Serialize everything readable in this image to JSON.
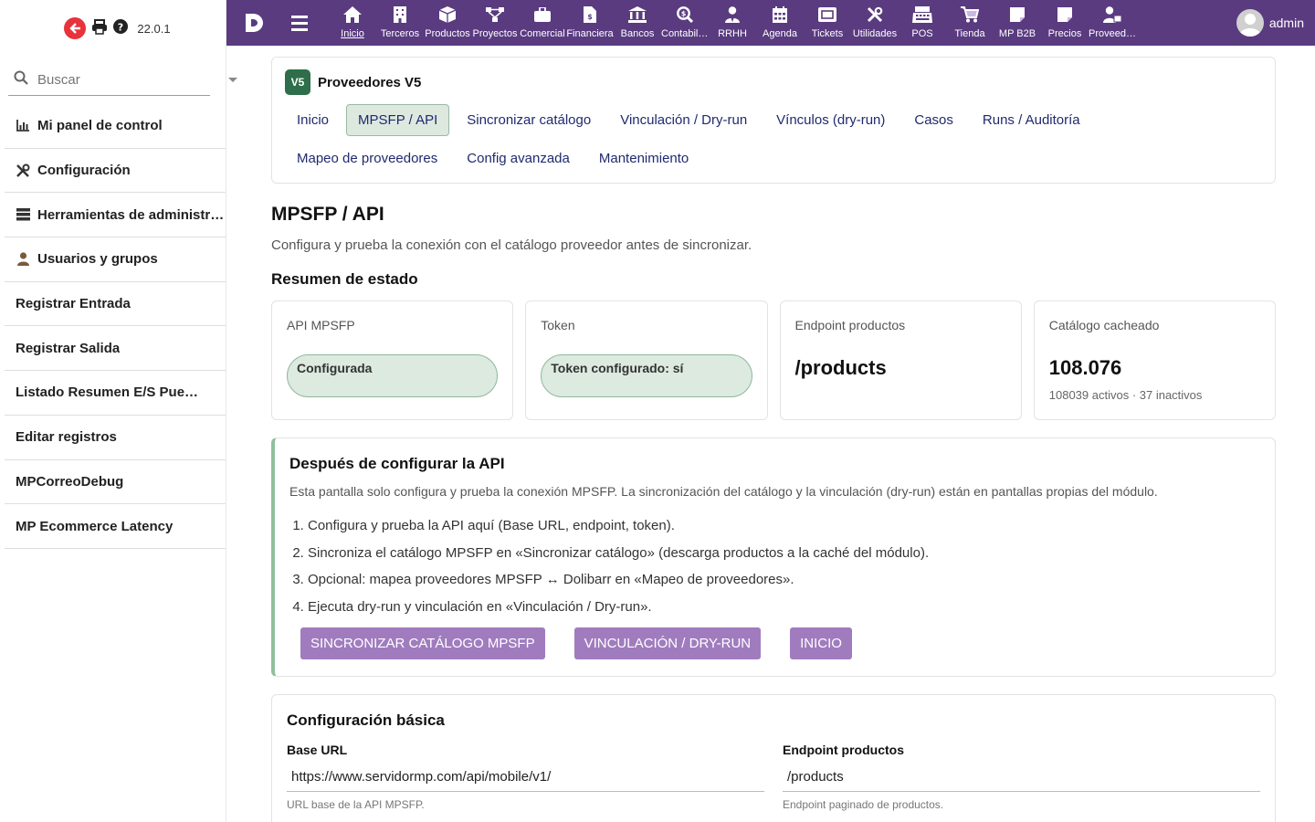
{
  "app": {
    "version": "22.0.1"
  },
  "sidebar": {
    "search_placeholder": "Buscar",
    "items": [
      {
        "label": "Mi panel de control",
        "icon": "bar-chart-icon"
      },
      {
        "label": "Configuración",
        "icon": "tools-icon"
      },
      {
        "label": "Herramientas de administración",
        "icon": "server-icon"
      },
      {
        "label": "Usuarios y grupos",
        "icon": "user-icon"
      },
      {
        "label": "Registrar Entrada"
      },
      {
        "label": "Registrar Salida"
      },
      {
        "label": "Listado Resumen E/S Puesto de trabajo"
      },
      {
        "label": "Editar registros"
      },
      {
        "label": "MPCorreoDebug"
      },
      {
        "label": "MP Ecommerce Latency"
      }
    ]
  },
  "topnav": {
    "items": [
      {
        "label": "Inicio",
        "icon": "home-icon"
      },
      {
        "label": "Terceros",
        "icon": "building-icon"
      },
      {
        "label": "Productos",
        "icon": "cube-icon"
      },
      {
        "label": "Proyectos",
        "icon": "sitemap-icon"
      },
      {
        "label": "Comercial",
        "icon": "briefcase-icon"
      },
      {
        "label": "Financiera",
        "icon": "invoice-icon"
      },
      {
        "label": "Bancos",
        "icon": "bank-icon"
      },
      {
        "label": "Contabilidad",
        "icon": "search-dollar-icon"
      },
      {
        "label": "RRHH",
        "icon": "user-tie-icon"
      },
      {
        "label": "Agenda",
        "icon": "calendar-icon"
      },
      {
        "label": "Tickets",
        "icon": "ticket-icon"
      },
      {
        "label": "Utilidades",
        "icon": "tools-icon"
      },
      {
        "label": "POS",
        "icon": "cash-register-icon"
      },
      {
        "label": "Tienda",
        "icon": "cart-icon"
      },
      {
        "label": "MP B2B",
        "icon": "note-icon"
      },
      {
        "label": "Precios",
        "icon": "note-icon"
      },
      {
        "label": "Proveedores",
        "icon": "user-supplier-icon"
      }
    ],
    "user": "admin"
  },
  "module": {
    "badge": "V5",
    "name": "Proveedores V5",
    "tabs": [
      {
        "label": "Inicio",
        "active": false
      },
      {
        "label": "MPSFP / API",
        "active": true
      },
      {
        "label": "Sincronizar catálogo",
        "active": false
      },
      {
        "label": "Vinculación / Dry-run",
        "active": false
      },
      {
        "label": "Vínculos (dry-run)",
        "active": false
      },
      {
        "label": "Casos",
        "active": false
      },
      {
        "label": "Runs / Auditoría",
        "active": false
      },
      {
        "label": "Mapeo de proveedores",
        "active": false
      },
      {
        "label": "Config avanzada",
        "active": false
      },
      {
        "label": "Mantenimiento",
        "active": false
      }
    ]
  },
  "page": {
    "title": "MPSFP / API",
    "subtitle": "Configura y prueba la conexión con el catálogo proveedor antes de sincronizar.",
    "status_heading": "Resumen de estado"
  },
  "status_cards": {
    "api": {
      "label": "API MPSFP",
      "value": "Configurada"
    },
    "token": {
      "label": "Token",
      "value": "Token configurado: sí"
    },
    "endpoint": {
      "label": "Endpoint productos",
      "value": "/products"
    },
    "catalog": {
      "label": "Catálogo cacheado",
      "value": "108.076",
      "note": "108039 activos · 37 inactivos"
    }
  },
  "info": {
    "heading": "Después de configurar la API",
    "description": "Esta pantalla solo configura y prueba la conexión MPSFP. La sincronización del catálogo y la vinculación (dry-run) están en pantallas propias del módulo.",
    "steps": [
      "Configura y prueba la API aquí (Base URL, endpoint, token).",
      "Sincroniza el catálogo MPSFP en «Sincronizar catálogo» (descarga productos a la caché del módulo).",
      "Opcional: mapea proveedores MPSFP ↔ Dolibarr en «Mapeo de proveedores».",
      "Ejecuta dry-run y vinculación en «Vinculación / Dry-run»."
    ],
    "buttons": {
      "sync": "Sincronizar catálogo MPSFP",
      "link": "Vinculación / Dry-run",
      "home": "Inicio"
    }
  },
  "config": {
    "heading": "Configuración básica",
    "base_url": {
      "label": "Base URL",
      "value": "https://www.servidormp.com/api/mobile/v1/",
      "help": "URL base de la API MPSFP."
    },
    "endpoint": {
      "label": "Endpoint productos",
      "value": "/products",
      "help": "Endpoint paginado de productos."
    }
  },
  "colors": {
    "topbar": "#5a3b80",
    "button": "#a07cbf",
    "success_pill": "#dceadf",
    "badge": "#2e6e4a"
  }
}
